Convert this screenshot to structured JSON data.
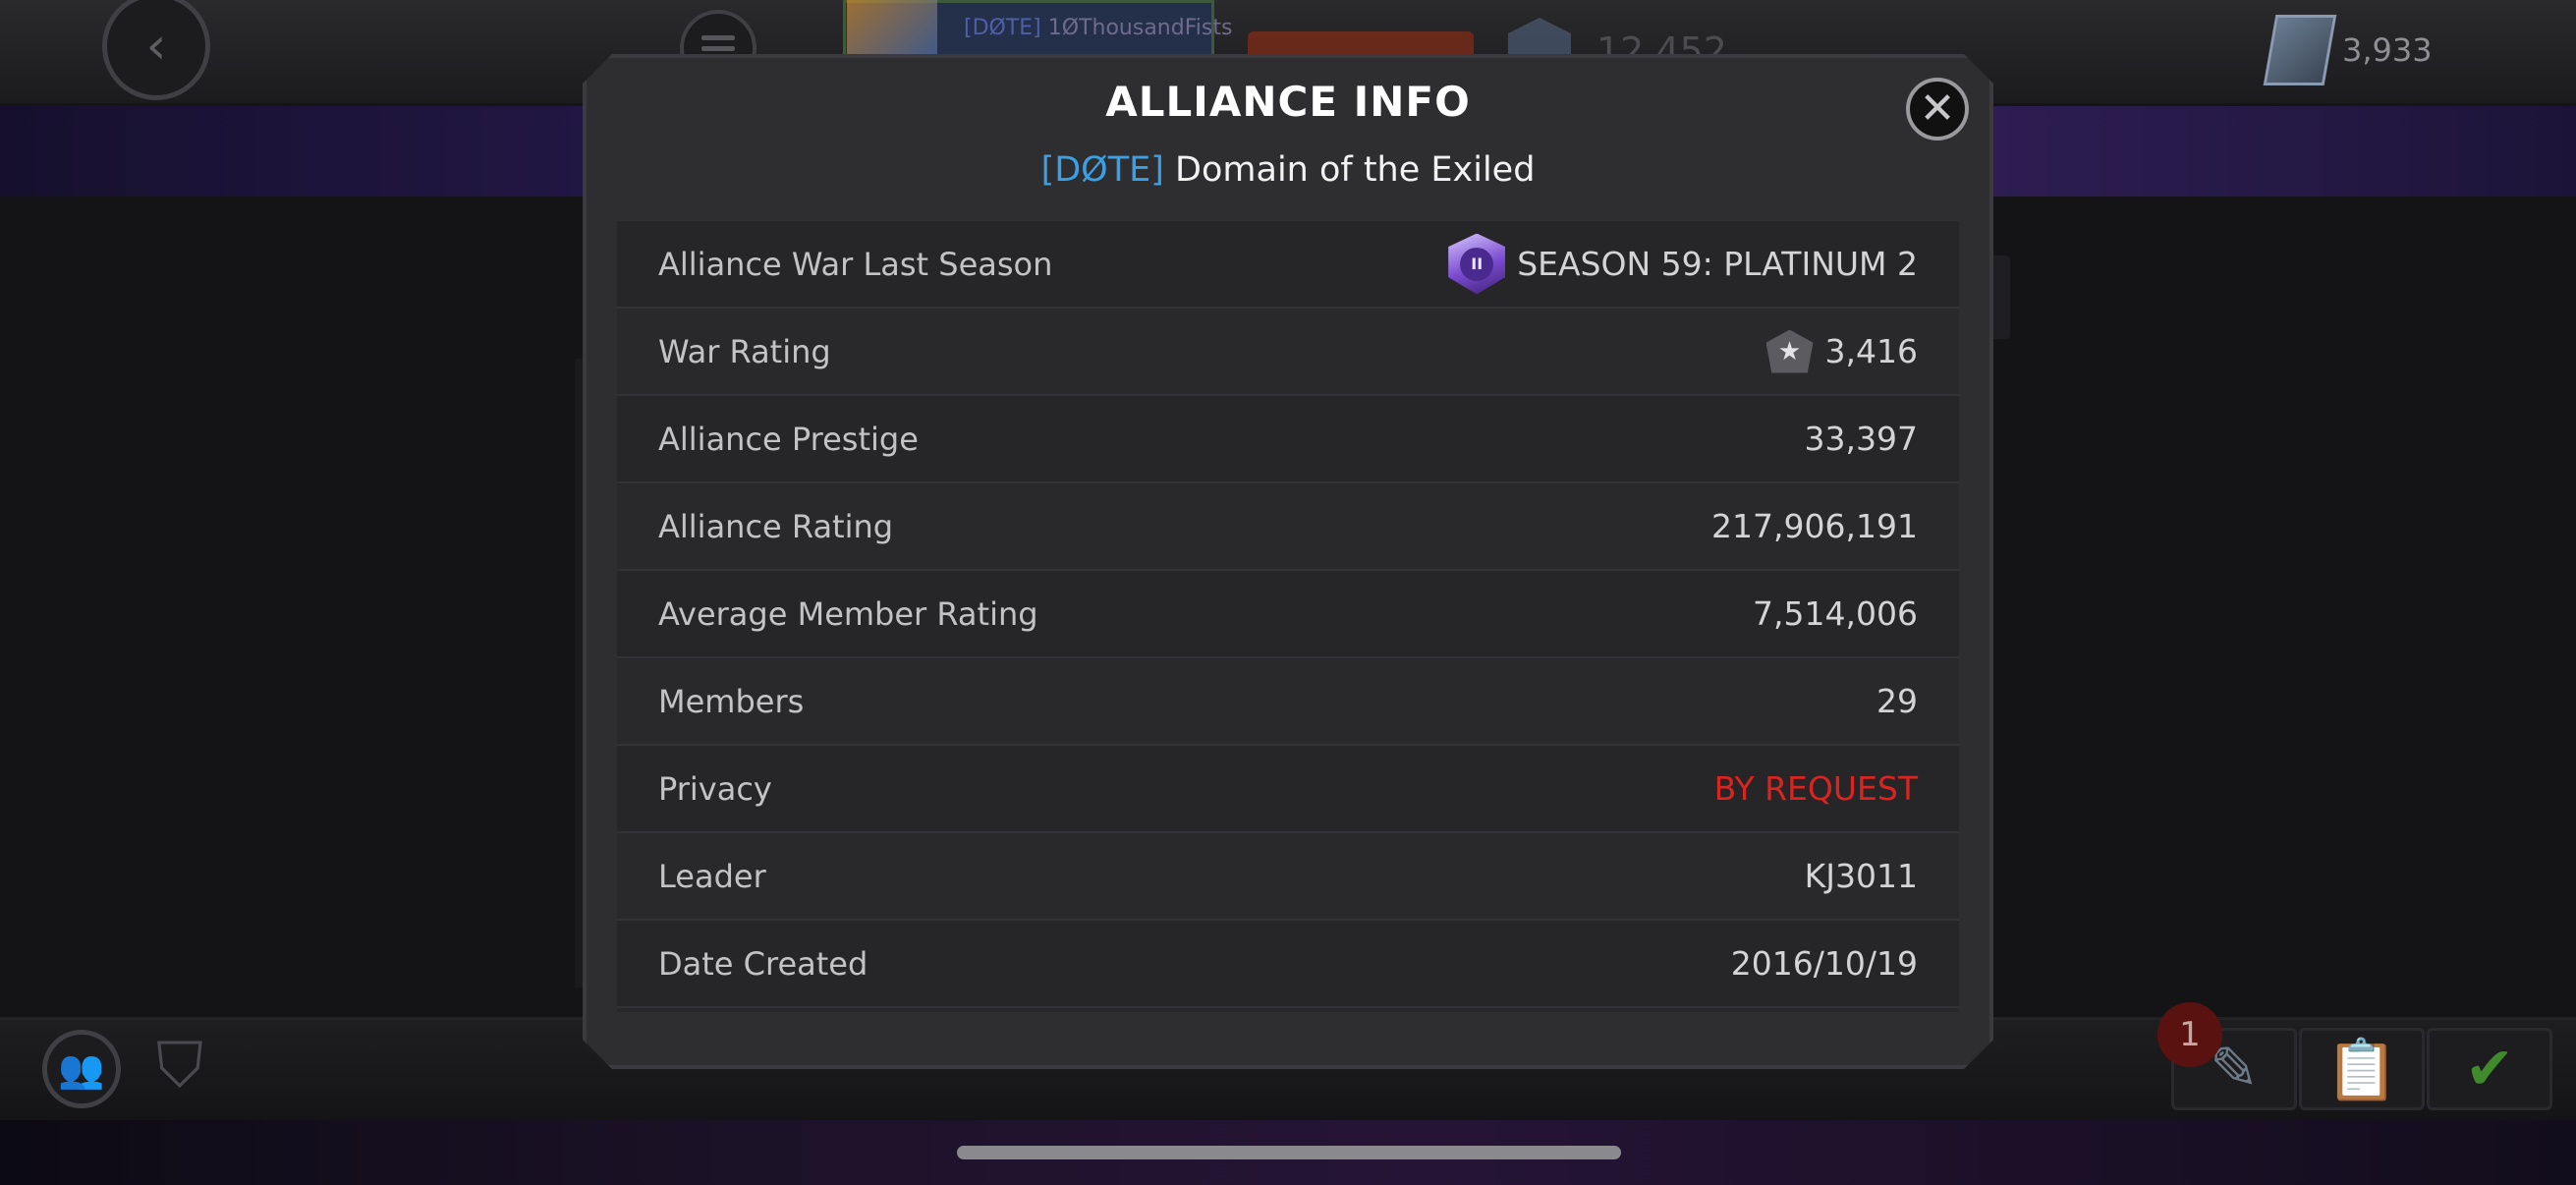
{
  "background": {
    "profile_tag": "[DØTE]",
    "profile_name": "1ØThousandFists",
    "rating_text": "12,452",
    "units_count": "3,933",
    "notification_count": "1"
  },
  "modal": {
    "title": "ALLIANCE INFO",
    "alliance_tag": "[DØTE]",
    "alliance_name": "Domain of the Exiled",
    "close_label": "✕",
    "rows": [
      {
        "label": "Alliance War Last Season",
        "value": "SEASON 59: PLATINUM 2",
        "icon": "season-badge-icon",
        "badge_text": "II"
      },
      {
        "label": "War Rating",
        "value": "3,416",
        "icon": "war-rating-icon"
      },
      {
        "label": "Alliance Prestige",
        "value": "33,397"
      },
      {
        "label": "Alliance Rating",
        "value": "217,906,191"
      },
      {
        "label": "Average Member Rating",
        "value": "7,514,006"
      },
      {
        "label": "Members",
        "value": "29"
      },
      {
        "label": "Privacy",
        "value": "BY REQUEST",
        "color": "#d9241f"
      },
      {
        "label": "Leader",
        "value": "KJ3011"
      },
      {
        "label": "Date Created",
        "value": "2016/10/19"
      }
    ]
  },
  "colors": {
    "accent_blue": "#3c9fe3",
    "privacy_red": "#d9241f",
    "modal_bg": "#2e2e31"
  }
}
